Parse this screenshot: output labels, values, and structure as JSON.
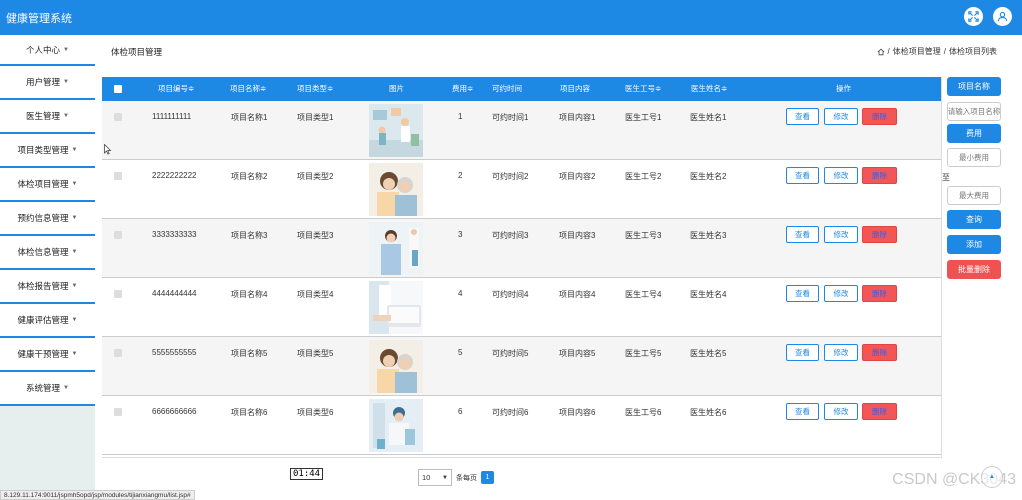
{
  "app": {
    "title": "健康管理系统"
  },
  "header_icons": {
    "fullscreen": "fullscreen-icon",
    "user": "user-icon"
  },
  "colors": {
    "primary": "#1e88e5",
    "danger": "#f25656",
    "sidebar_bg": "#e6efed"
  },
  "sidebar": {
    "items": [
      {
        "label": "个人中心"
      },
      {
        "label": "用户管理"
      },
      {
        "label": "医生管理"
      },
      {
        "label": "项目类型管理"
      },
      {
        "label": "体检项目管理"
      },
      {
        "label": "预约信息管理"
      },
      {
        "label": "体检信息管理"
      },
      {
        "label": "体检报告管理"
      },
      {
        "label": "健康评估管理"
      },
      {
        "label": "健康干预管理"
      },
      {
        "label": "系统管理"
      }
    ]
  },
  "page": {
    "title": "体检项目管理",
    "breadcrumb": [
      "体检项目管理",
      "体检项目列表"
    ],
    "breadcrumb_sep": "/"
  },
  "table": {
    "columns": [
      "项目编号",
      "项目名称",
      "项目类型",
      "图片",
      "费用",
      "可约时间",
      "项目内容",
      "医生工号",
      "医生姓名",
      "操作"
    ],
    "sort_mark": "≑",
    "actions": {
      "view": "查看",
      "edit": "修改",
      "delete": "删除"
    },
    "rows": [
      {
        "code": "1111111111",
        "name": "项目名称1",
        "type": "项目类型1",
        "fee": "1",
        "time": "可约时间1",
        "content": "项目内容1",
        "doc_id": "医生工号1",
        "doc_name": "医生姓名1"
      },
      {
        "code": "2222222222",
        "name": "项目名称2",
        "type": "项目类型2",
        "fee": "2",
        "time": "可约时间2",
        "content": "项目内容2",
        "doc_id": "医生工号2",
        "doc_name": "医生姓名2"
      },
      {
        "code": "3333333333",
        "name": "项目名称3",
        "type": "项目类型3",
        "fee": "3",
        "time": "可约时间3",
        "content": "项目内容3",
        "doc_id": "医生工号3",
        "doc_name": "医生姓名3"
      },
      {
        "code": "4444444444",
        "name": "项目名称4",
        "type": "项目类型4",
        "fee": "4",
        "time": "可约时间4",
        "content": "项目内容4",
        "doc_id": "医生工号4",
        "doc_name": "医生姓名4"
      },
      {
        "code": "5555555555",
        "name": "项目名称5",
        "type": "项目类型5",
        "fee": "5",
        "time": "可约时间5",
        "content": "项目内容5",
        "doc_id": "医生工号5",
        "doc_name": "医生姓名5"
      },
      {
        "code": "6666666666",
        "name": "项目名称6",
        "type": "项目类型6",
        "fee": "6",
        "time": "可约时间6",
        "content": "项目内容6",
        "doc_id": "医生工号6",
        "doc_name": "医生姓名6"
      }
    ]
  },
  "filters": {
    "name_label": "项目名称",
    "name_placeholder": "请输入项目名称",
    "fee_label": "费用",
    "min_fee_placeholder": "最小费用",
    "to_label": "至",
    "max_fee_placeholder": "最大费用",
    "search_button": "查询",
    "add_button": "添加",
    "batch_delete_button": "批量删除"
  },
  "pagination": {
    "page_size": "10",
    "per_page_label": "条每页",
    "current_page": "1"
  },
  "overlay": {
    "timer": "01:44",
    "status_url": "8.129.11.174:9011/jspmh5opd/jsp/modules/tijianxiangmu/list.jsp#",
    "watermark": "CSDN @CK3043"
  }
}
